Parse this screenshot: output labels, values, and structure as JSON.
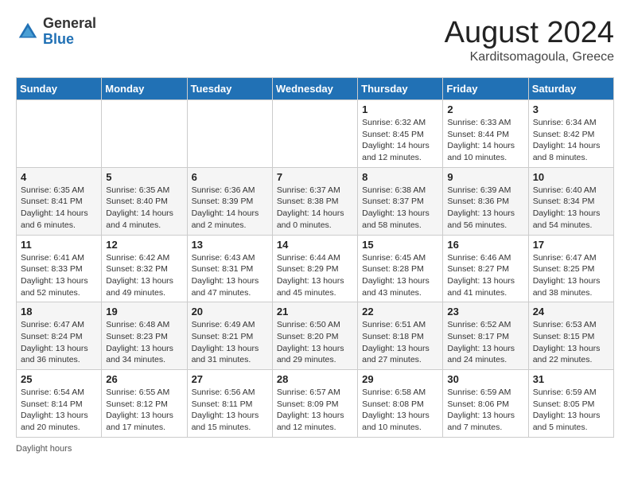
{
  "header": {
    "logo_general": "General",
    "logo_blue": "Blue",
    "month_title": "August 2024",
    "location": "Karditsomagoula, Greece"
  },
  "days_of_week": [
    "Sunday",
    "Monday",
    "Tuesday",
    "Wednesday",
    "Thursday",
    "Friday",
    "Saturday"
  ],
  "weeks": [
    [
      {
        "day": "",
        "info": ""
      },
      {
        "day": "",
        "info": ""
      },
      {
        "day": "",
        "info": ""
      },
      {
        "day": "",
        "info": ""
      },
      {
        "day": "1",
        "info": "Sunrise: 6:32 AM\nSunset: 8:45 PM\nDaylight: 14 hours\nand 12 minutes."
      },
      {
        "day": "2",
        "info": "Sunrise: 6:33 AM\nSunset: 8:44 PM\nDaylight: 14 hours\nand 10 minutes."
      },
      {
        "day": "3",
        "info": "Sunrise: 6:34 AM\nSunset: 8:42 PM\nDaylight: 14 hours\nand 8 minutes."
      }
    ],
    [
      {
        "day": "4",
        "info": "Sunrise: 6:35 AM\nSunset: 8:41 PM\nDaylight: 14 hours\nand 6 minutes."
      },
      {
        "day": "5",
        "info": "Sunrise: 6:35 AM\nSunset: 8:40 PM\nDaylight: 14 hours\nand 4 minutes."
      },
      {
        "day": "6",
        "info": "Sunrise: 6:36 AM\nSunset: 8:39 PM\nDaylight: 14 hours\nand 2 minutes."
      },
      {
        "day": "7",
        "info": "Sunrise: 6:37 AM\nSunset: 8:38 PM\nDaylight: 14 hours\nand 0 minutes."
      },
      {
        "day": "8",
        "info": "Sunrise: 6:38 AM\nSunset: 8:37 PM\nDaylight: 13 hours\nand 58 minutes."
      },
      {
        "day": "9",
        "info": "Sunrise: 6:39 AM\nSunset: 8:36 PM\nDaylight: 13 hours\nand 56 minutes."
      },
      {
        "day": "10",
        "info": "Sunrise: 6:40 AM\nSunset: 8:34 PM\nDaylight: 13 hours\nand 54 minutes."
      }
    ],
    [
      {
        "day": "11",
        "info": "Sunrise: 6:41 AM\nSunset: 8:33 PM\nDaylight: 13 hours\nand 52 minutes."
      },
      {
        "day": "12",
        "info": "Sunrise: 6:42 AM\nSunset: 8:32 PM\nDaylight: 13 hours\nand 49 minutes."
      },
      {
        "day": "13",
        "info": "Sunrise: 6:43 AM\nSunset: 8:31 PM\nDaylight: 13 hours\nand 47 minutes."
      },
      {
        "day": "14",
        "info": "Sunrise: 6:44 AM\nSunset: 8:29 PM\nDaylight: 13 hours\nand 45 minutes."
      },
      {
        "day": "15",
        "info": "Sunrise: 6:45 AM\nSunset: 8:28 PM\nDaylight: 13 hours\nand 43 minutes."
      },
      {
        "day": "16",
        "info": "Sunrise: 6:46 AM\nSunset: 8:27 PM\nDaylight: 13 hours\nand 41 minutes."
      },
      {
        "day": "17",
        "info": "Sunrise: 6:47 AM\nSunset: 8:25 PM\nDaylight: 13 hours\nand 38 minutes."
      }
    ],
    [
      {
        "day": "18",
        "info": "Sunrise: 6:47 AM\nSunset: 8:24 PM\nDaylight: 13 hours\nand 36 minutes."
      },
      {
        "day": "19",
        "info": "Sunrise: 6:48 AM\nSunset: 8:23 PM\nDaylight: 13 hours\nand 34 minutes."
      },
      {
        "day": "20",
        "info": "Sunrise: 6:49 AM\nSunset: 8:21 PM\nDaylight: 13 hours\nand 31 minutes."
      },
      {
        "day": "21",
        "info": "Sunrise: 6:50 AM\nSunset: 8:20 PM\nDaylight: 13 hours\nand 29 minutes."
      },
      {
        "day": "22",
        "info": "Sunrise: 6:51 AM\nSunset: 8:18 PM\nDaylight: 13 hours\nand 27 minutes."
      },
      {
        "day": "23",
        "info": "Sunrise: 6:52 AM\nSunset: 8:17 PM\nDaylight: 13 hours\nand 24 minutes."
      },
      {
        "day": "24",
        "info": "Sunrise: 6:53 AM\nSunset: 8:15 PM\nDaylight: 13 hours\nand 22 minutes."
      }
    ],
    [
      {
        "day": "25",
        "info": "Sunrise: 6:54 AM\nSunset: 8:14 PM\nDaylight: 13 hours\nand 20 minutes."
      },
      {
        "day": "26",
        "info": "Sunrise: 6:55 AM\nSunset: 8:12 PM\nDaylight: 13 hours\nand 17 minutes."
      },
      {
        "day": "27",
        "info": "Sunrise: 6:56 AM\nSunset: 8:11 PM\nDaylight: 13 hours\nand 15 minutes."
      },
      {
        "day": "28",
        "info": "Sunrise: 6:57 AM\nSunset: 8:09 PM\nDaylight: 13 hours\nand 12 minutes."
      },
      {
        "day": "29",
        "info": "Sunrise: 6:58 AM\nSunset: 8:08 PM\nDaylight: 13 hours\nand 10 minutes."
      },
      {
        "day": "30",
        "info": "Sunrise: 6:59 AM\nSunset: 8:06 PM\nDaylight: 13 hours\nand 7 minutes."
      },
      {
        "day": "31",
        "info": "Sunrise: 6:59 AM\nSunset: 8:05 PM\nDaylight: 13 hours\nand 5 minutes."
      }
    ]
  ],
  "footer": {
    "note": "Daylight hours"
  }
}
